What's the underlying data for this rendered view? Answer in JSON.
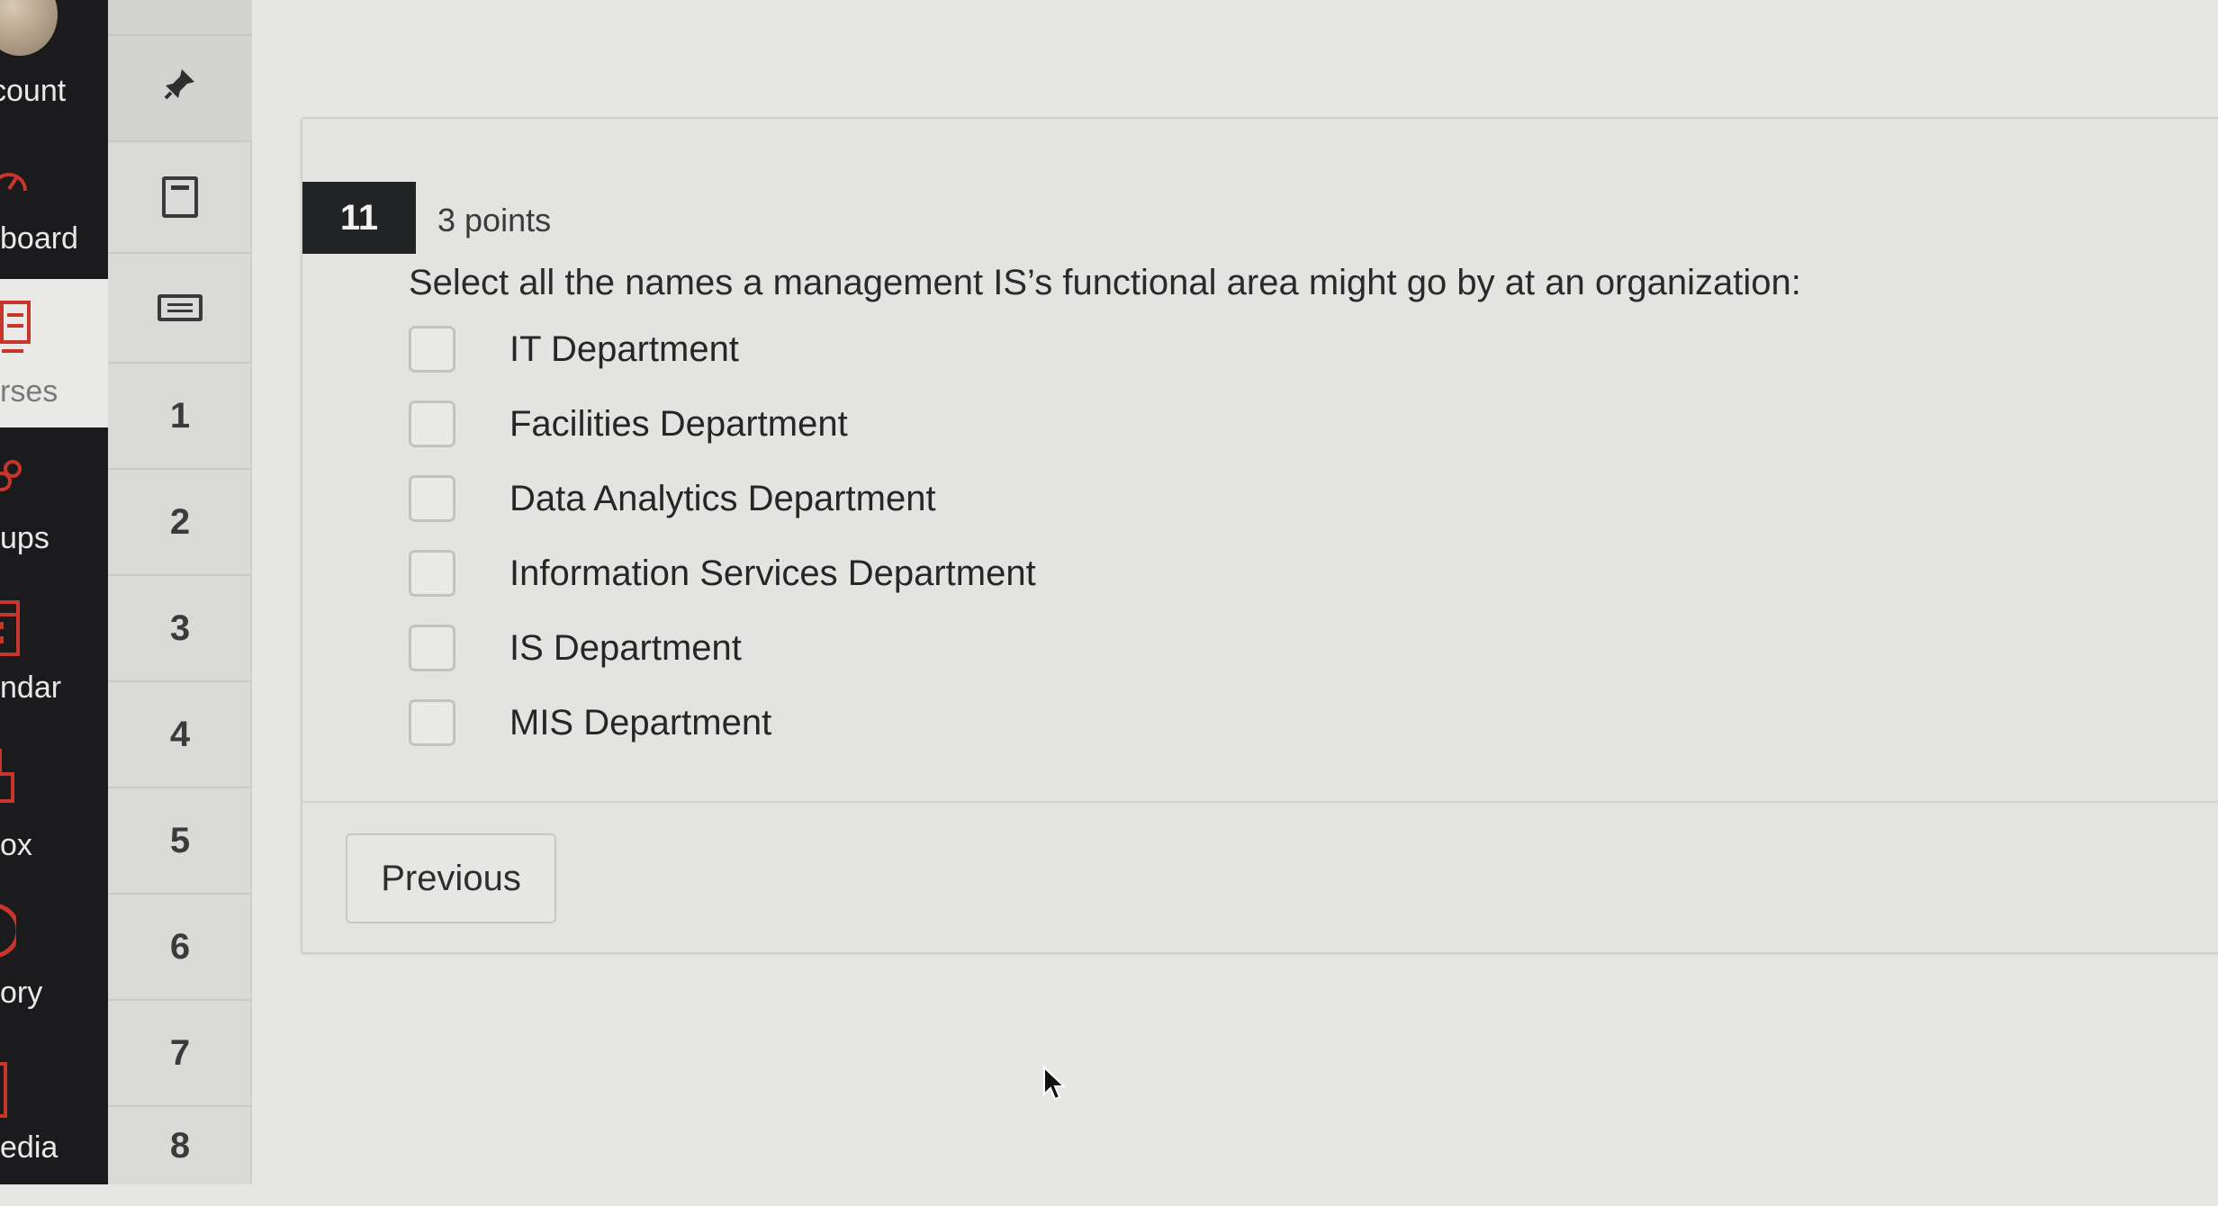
{
  "global_nav": {
    "items": [
      {
        "label": "count",
        "icon": "user-avatar-icon"
      },
      {
        "label": "board",
        "icon": "dashboard-icon"
      },
      {
        "label": "rses",
        "icon": "courses-icon"
      },
      {
        "label": "ups",
        "icon": "groups-icon"
      },
      {
        "label": "ndar",
        "icon": "calendar-icon"
      },
      {
        "label": "ox",
        "icon": "inbox-icon"
      },
      {
        "label": "ory",
        "icon": "history-icon"
      },
      {
        "label": "edia",
        "icon": "media-icon"
      }
    ],
    "accent_color": "#c7352b"
  },
  "question_nav": {
    "numbers": [
      "1",
      "2",
      "3",
      "4",
      "5",
      "6",
      "7",
      "8"
    ]
  },
  "question": {
    "number": "11",
    "points": "3 points",
    "text": "Select all the names a management IS’s functional area might go by at an organization:",
    "answers": [
      {
        "label": "IT Department",
        "checked": false
      },
      {
        "label": "Facilities Department",
        "checked": false
      },
      {
        "label": "Data Analytics Department",
        "checked": false
      },
      {
        "label": "Information Services Department",
        "checked": false
      },
      {
        "label": "IS Department",
        "checked": false
      },
      {
        "label": "MIS Department",
        "checked": false
      }
    ]
  },
  "footer": {
    "previous_label": "Previous"
  }
}
